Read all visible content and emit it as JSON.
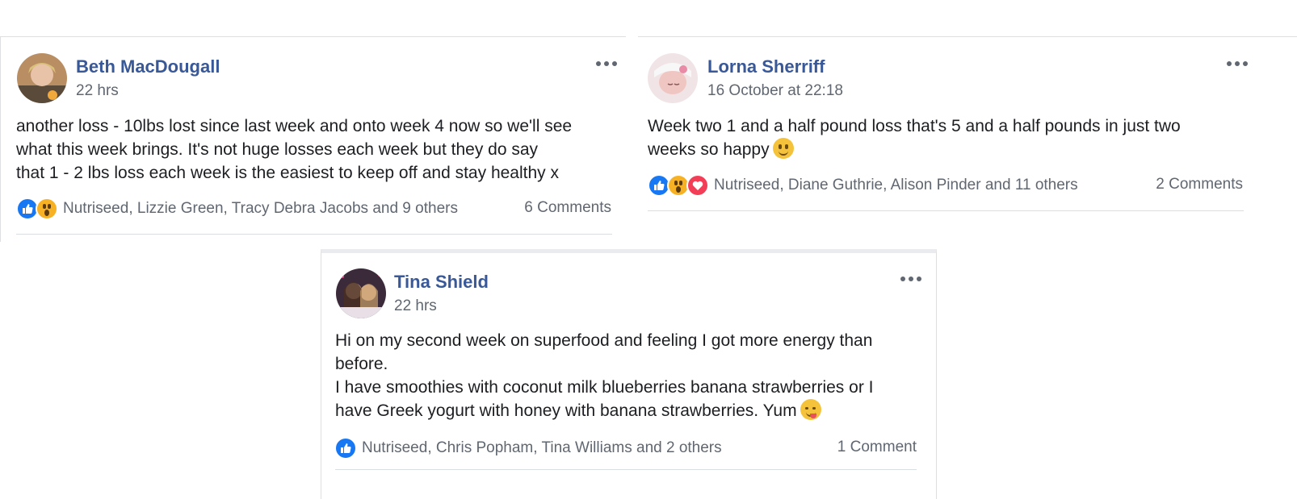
{
  "posts": [
    {
      "author": "Beth MacDougall",
      "time": "22 hrs",
      "text": "another loss - 10lbs lost since last week and onto week 4 now so we'll see\nwhat this week brings. It's not huge losses each week but they do say\nthat 1 - 2 lbs loss each week is the easiest to keep off and stay healthy x",
      "reactions_text": "Nutriseed, Lizzie Green, Tracy Debra Jacobs and 9 others",
      "reaction_icons": [
        "like-icon",
        "wow-icon"
      ],
      "comments": "6 Comments"
    },
    {
      "author": "Lorna Sherriff",
      "time": "16 October at 22:18",
      "text": "Week two 1 and a half pound loss that's 5 and a half pounds in just two\nweeks so happy",
      "emoji": "smiling-face-icon",
      "reactions_text": "Nutriseed, Diane Guthrie, Alison Pinder and 11 others",
      "reaction_icons": [
        "like-icon",
        "wow-icon",
        "love-icon"
      ],
      "comments": "2 Comments"
    },
    {
      "author": "Tina Shield",
      "time": "22 hrs",
      "text": "Hi on my second week on superfood and feeling I got more energy than\nbefore.\nI have smoothies with coconut milk blueberries banana strawberries or I\nhave Greek yogurt with honey with banana strawberries. Yum",
      "emoji": "savoring-food-face-icon",
      "reactions_text": "Nutriseed, Chris Popham, Tina Williams and 2 others",
      "reaction_icons": [
        "like-icon"
      ],
      "comments": "1 Comment"
    }
  ],
  "colors": {
    "author": "#385898",
    "secondary_text": "#606770",
    "like": "#1877f2",
    "love": "#f33e58",
    "wow": "#f7b125"
  }
}
